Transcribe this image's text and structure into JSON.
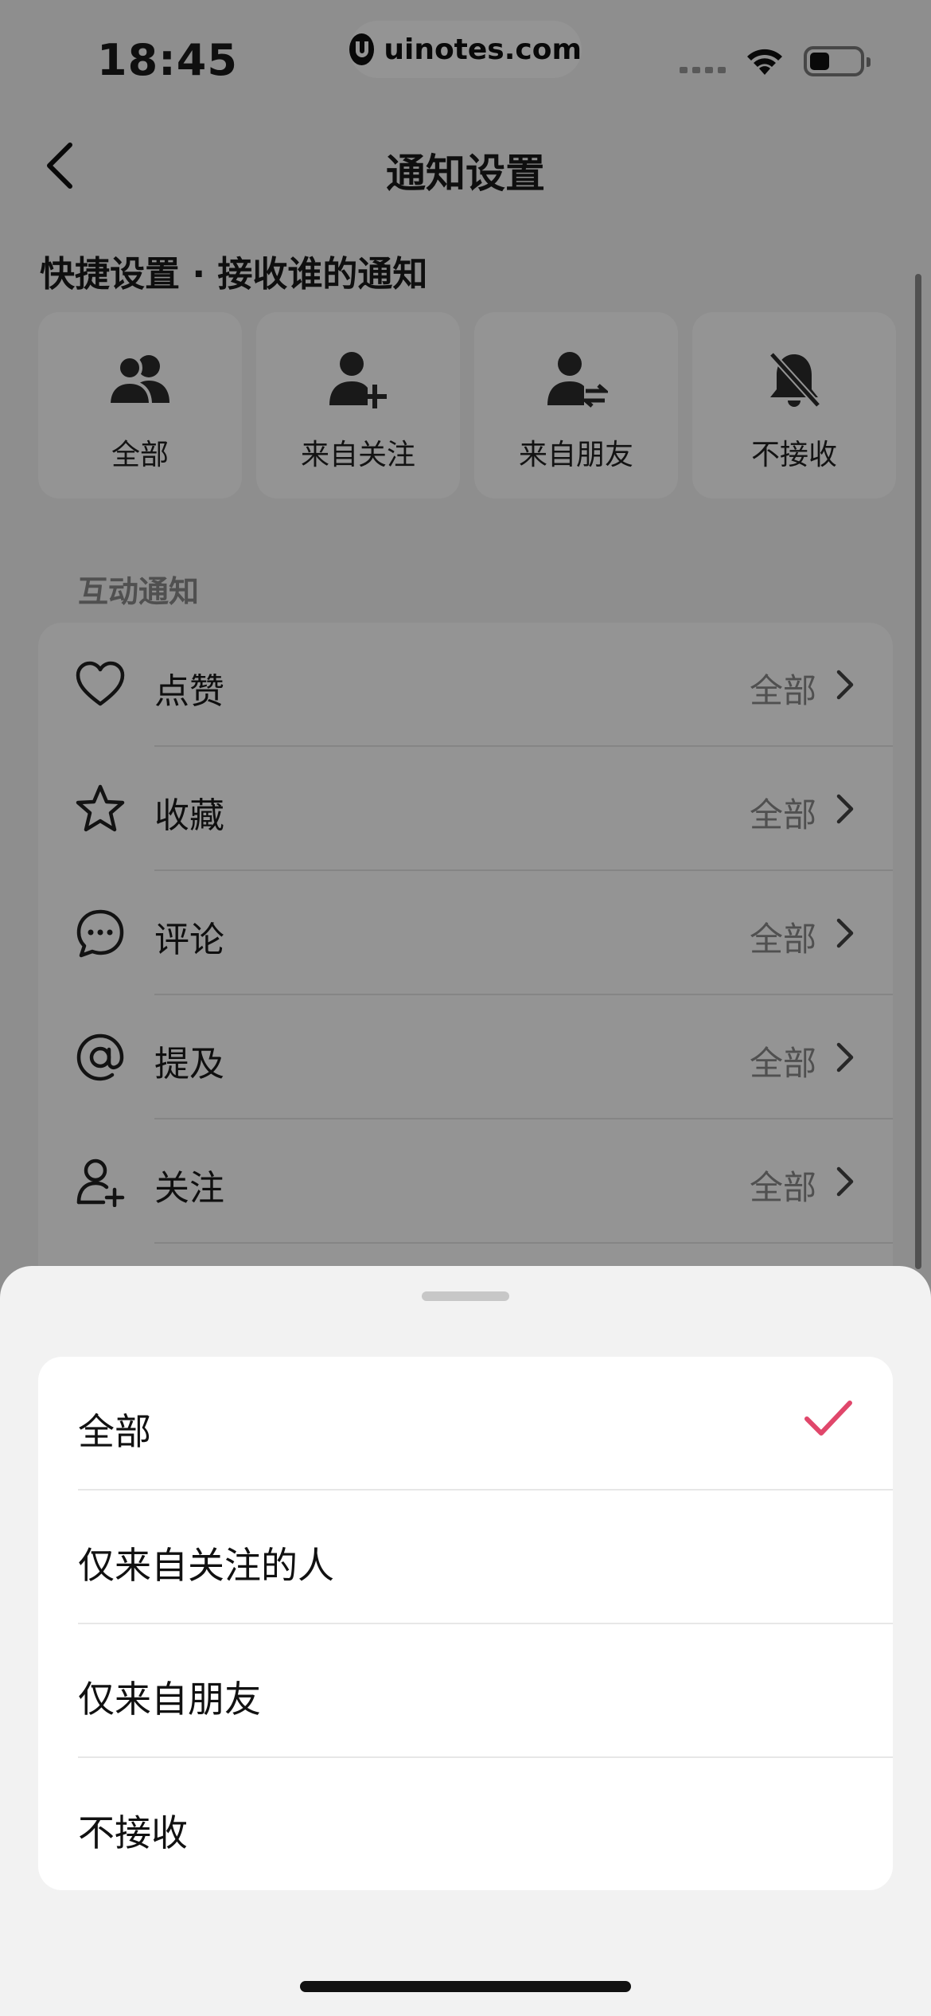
{
  "status_bar": {
    "time": "18:45",
    "watermark": "uinotes.com"
  },
  "header": {
    "title": "通知设置"
  },
  "quick_settings": {
    "heading": "快捷设置 · 接收谁的通知",
    "cards": [
      {
        "label": "全部",
        "icon": "group-icon"
      },
      {
        "label": "来自关注",
        "icon": "user-add-icon"
      },
      {
        "label": "来自朋友",
        "icon": "user-swap-icon"
      },
      {
        "label": "不接收",
        "icon": "bell-off-icon"
      }
    ]
  },
  "interaction_notifications": {
    "label": "互动通知",
    "rows": [
      {
        "title": "点赞",
        "value": "全部",
        "icon": "heart-icon"
      },
      {
        "title": "收藏",
        "value": "全部",
        "icon": "star-icon"
      },
      {
        "title": "评论",
        "value": "全部",
        "icon": "comment-icon"
      },
      {
        "title": "提及",
        "value": "全部",
        "icon": "at-icon"
      },
      {
        "title": "关注",
        "value": "全部",
        "icon": "user-plus-icon"
      }
    ]
  },
  "bottom_sheet": {
    "options": [
      {
        "label": "全部",
        "selected": true
      },
      {
        "label": "仅来自关注的人",
        "selected": false
      },
      {
        "label": "仅来自朋友",
        "selected": false
      },
      {
        "label": "不接收",
        "selected": false
      }
    ]
  },
  "colors": {
    "accent": "#e0476b",
    "overlay": "#000000"
  }
}
